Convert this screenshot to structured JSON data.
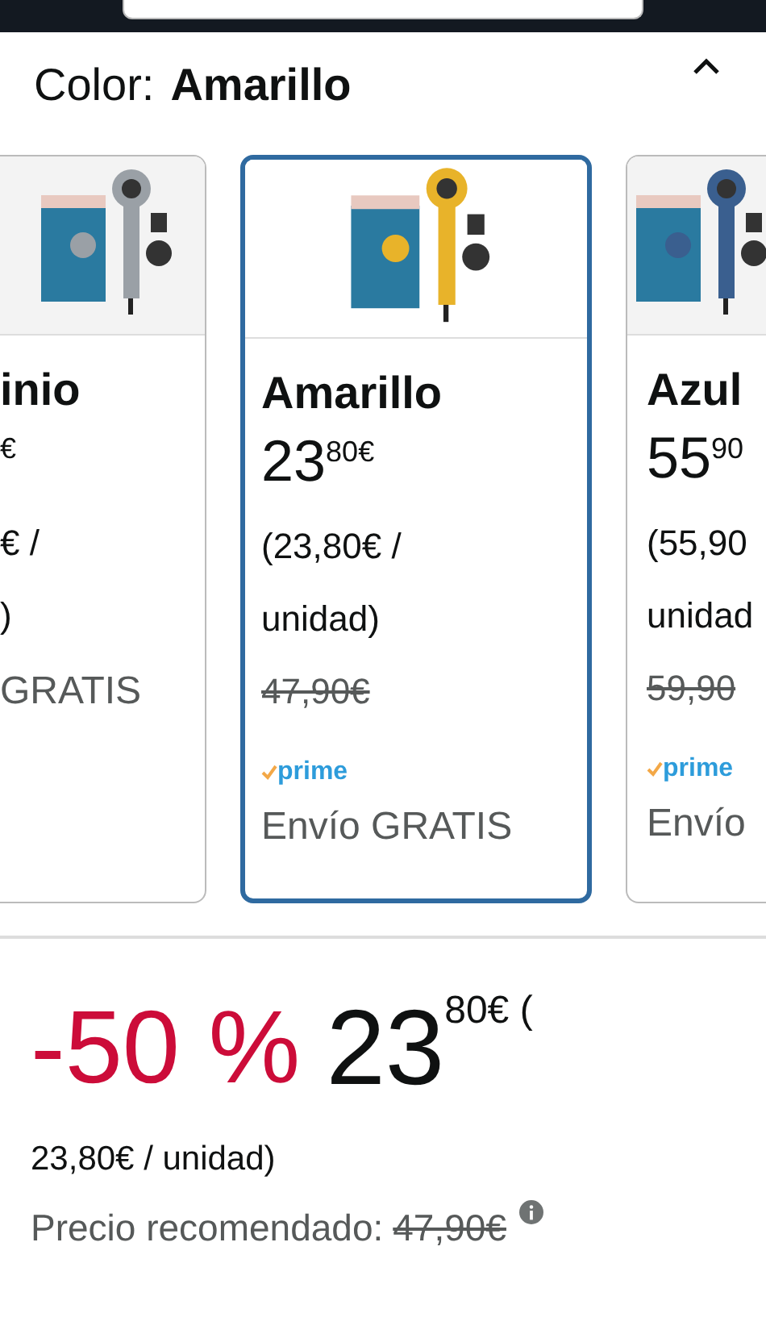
{
  "color_selector": {
    "label": "Color:",
    "value": "Amarillo",
    "expanded": true
  },
  "variants": [
    {
      "name": "inio",
      "price_fraction": "€",
      "unit_price_lines": [
        "€ /",
        ")"
      ],
      "shipping": "GRATIS",
      "selected": false
    },
    {
      "name": "Amarillo",
      "price_whole": "23",
      "price_fraction": "80€",
      "unit_price_lines": [
        "(23,80€ /",
        "unidad)"
      ],
      "list_price": "47,90€",
      "prime_label": "prime",
      "shipping": "Envío GRATIS",
      "selected": true
    },
    {
      "name": "Azul",
      "price_whole": "55",
      "price_fraction": "90",
      "unit_price_lines": [
        "(55,90",
        "unidad"
      ],
      "list_price": "59,90",
      "prime_label": "prime",
      "shipping": "Envío",
      "selected": false
    }
  ],
  "price": {
    "discount": "-50 %",
    "whole": "23",
    "fraction": "80€ (",
    "unit_price": "23,80€ / unidad)",
    "list_price_label": "Precio recomendado:",
    "list_price": "47,90€"
  }
}
